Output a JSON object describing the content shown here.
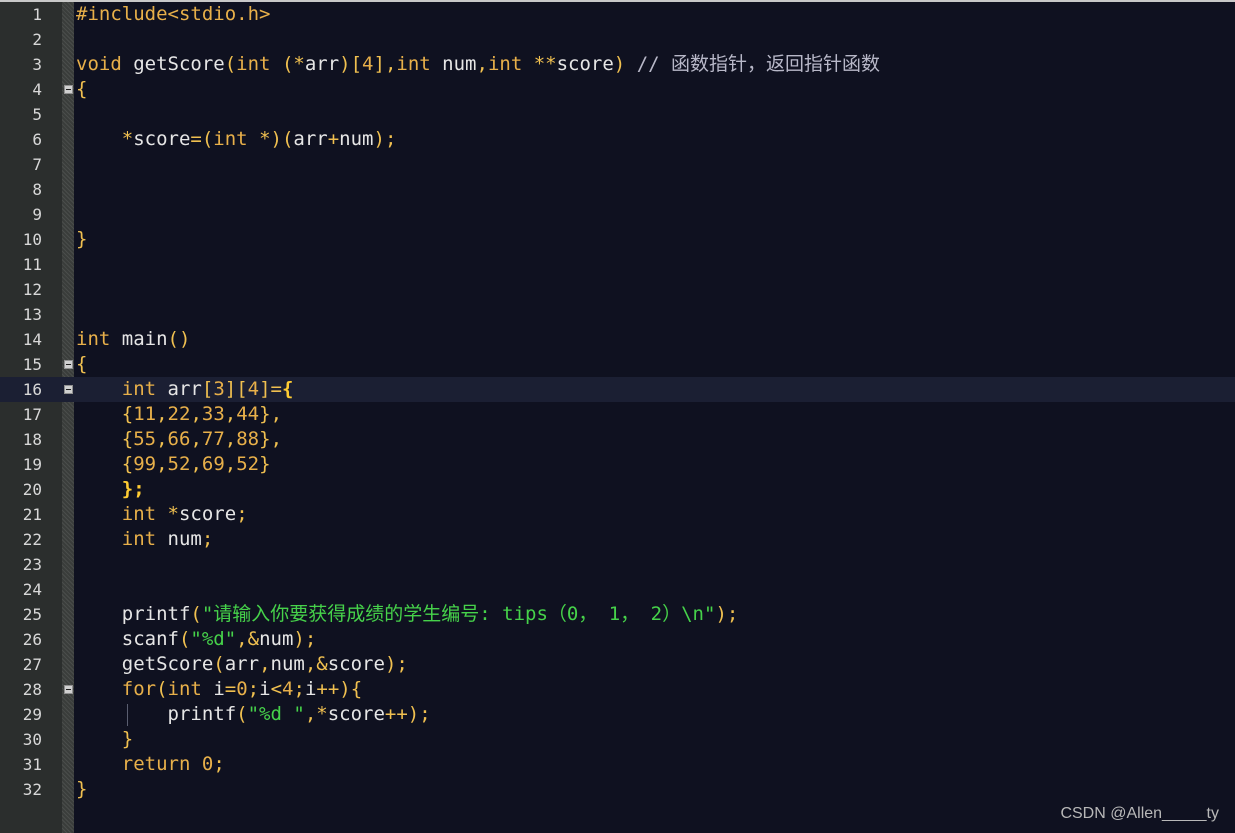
{
  "editor": {
    "current_line": 16,
    "lines": [
      {
        "num": "1",
        "fold": false,
        "tokens": [
          {
            "t": "#include<stdio.h>",
            "c": "pre"
          }
        ]
      },
      {
        "num": "2",
        "fold": false,
        "tokens": []
      },
      {
        "num": "3",
        "fold": false,
        "tokens": [
          {
            "t": "void",
            "c": "kw"
          },
          {
            "t": " getScore",
            "c": "fn"
          },
          {
            "t": "(",
            "c": "op"
          },
          {
            "t": "int",
            "c": "kw"
          },
          {
            "t": " (*",
            "c": "op"
          },
          {
            "t": "arr",
            "c": "id"
          },
          {
            "t": ")[",
            "c": "op"
          },
          {
            "t": "4",
            "c": "num"
          },
          {
            "t": "],",
            "c": "op"
          },
          {
            "t": "int",
            "c": "kw"
          },
          {
            "t": " num",
            "c": "id"
          },
          {
            "t": ",",
            "c": "op"
          },
          {
            "t": "int",
            "c": "kw"
          },
          {
            "t": " **",
            "c": "op"
          },
          {
            "t": "score",
            "c": "id"
          },
          {
            "t": ") ",
            "c": "op"
          },
          {
            "t": "// 函数指针，返回指针函数",
            "c": "cm"
          }
        ]
      },
      {
        "num": "4",
        "fold": true,
        "tokens": [
          {
            "t": "{",
            "c": "br"
          }
        ]
      },
      {
        "num": "5",
        "fold": false,
        "tokens": []
      },
      {
        "num": "6",
        "fold": false,
        "tokens": [
          {
            "t": "    *",
            "c": "op"
          },
          {
            "t": "score",
            "c": "id"
          },
          {
            "t": "=(",
            "c": "op"
          },
          {
            "t": "int",
            "c": "kw"
          },
          {
            "t": " *)(",
            "c": "op"
          },
          {
            "t": "arr",
            "c": "id"
          },
          {
            "t": "+",
            "c": "op"
          },
          {
            "t": "num",
            "c": "id"
          },
          {
            "t": ");",
            "c": "op"
          }
        ]
      },
      {
        "num": "7",
        "fold": false,
        "tokens": []
      },
      {
        "num": "8",
        "fold": false,
        "tokens": []
      },
      {
        "num": "9",
        "fold": false,
        "tokens": []
      },
      {
        "num": "10",
        "fold": false,
        "tokens": [
          {
            "t": "}",
            "c": "br"
          }
        ]
      },
      {
        "num": "11",
        "fold": false,
        "tokens": []
      },
      {
        "num": "12",
        "fold": false,
        "tokens": []
      },
      {
        "num": "13",
        "fold": false,
        "tokens": []
      },
      {
        "num": "14",
        "fold": false,
        "tokens": [
          {
            "t": "int",
            "c": "kw"
          },
          {
            "t": " main",
            "c": "fn"
          },
          {
            "t": "()",
            "c": "op"
          }
        ]
      },
      {
        "num": "15",
        "fold": true,
        "tokens": [
          {
            "t": "{",
            "c": "br"
          }
        ]
      },
      {
        "num": "16",
        "fold": true,
        "tokens": [
          {
            "t": "    ",
            "c": "id"
          },
          {
            "t": "int",
            "c": "kw"
          },
          {
            "t": " arr",
            "c": "id"
          },
          {
            "t": "[",
            "c": "op"
          },
          {
            "t": "3",
            "c": "num"
          },
          {
            "t": "][",
            "c": "op"
          },
          {
            "t": "4",
            "c": "num"
          },
          {
            "t": "]=",
            "c": "op"
          },
          {
            "t": "{",
            "c": "bold"
          }
        ]
      },
      {
        "num": "17",
        "fold": false,
        "tokens": [
          {
            "t": "    {",
            "c": "op"
          },
          {
            "t": "11",
            "c": "num"
          },
          {
            "t": ",",
            "c": "op"
          },
          {
            "t": "22",
            "c": "num"
          },
          {
            "t": ",",
            "c": "op"
          },
          {
            "t": "33",
            "c": "num"
          },
          {
            "t": ",",
            "c": "op"
          },
          {
            "t": "44",
            "c": "num"
          },
          {
            "t": "},",
            "c": "op"
          }
        ]
      },
      {
        "num": "18",
        "fold": false,
        "tokens": [
          {
            "t": "    {",
            "c": "op"
          },
          {
            "t": "55",
            "c": "num"
          },
          {
            "t": ",",
            "c": "op"
          },
          {
            "t": "66",
            "c": "num"
          },
          {
            "t": ",",
            "c": "op"
          },
          {
            "t": "77",
            "c": "num"
          },
          {
            "t": ",",
            "c": "op"
          },
          {
            "t": "88",
            "c": "num"
          },
          {
            "t": "},",
            "c": "op"
          }
        ]
      },
      {
        "num": "19",
        "fold": false,
        "tokens": [
          {
            "t": "    {",
            "c": "op"
          },
          {
            "t": "99",
            "c": "num"
          },
          {
            "t": ",",
            "c": "op"
          },
          {
            "t": "52",
            "c": "num"
          },
          {
            "t": ",",
            "c": "op"
          },
          {
            "t": "69",
            "c": "num"
          },
          {
            "t": ",",
            "c": "op"
          },
          {
            "t": "52",
            "c": "num"
          },
          {
            "t": "}",
            "c": "op"
          }
        ]
      },
      {
        "num": "20",
        "fold": false,
        "tokens": [
          {
            "t": "    ",
            "c": "id"
          },
          {
            "t": "};",
            "c": "bold"
          }
        ]
      },
      {
        "num": "21",
        "fold": false,
        "tokens": [
          {
            "t": "    ",
            "c": "id"
          },
          {
            "t": "int",
            "c": "kw"
          },
          {
            "t": " *",
            "c": "op"
          },
          {
            "t": "score",
            "c": "id"
          },
          {
            "t": ";",
            "c": "op"
          }
        ]
      },
      {
        "num": "22",
        "fold": false,
        "tokens": [
          {
            "t": "    ",
            "c": "id"
          },
          {
            "t": "int",
            "c": "kw"
          },
          {
            "t": " num",
            "c": "id"
          },
          {
            "t": ";",
            "c": "op"
          }
        ]
      },
      {
        "num": "23",
        "fold": false,
        "tokens": []
      },
      {
        "num": "24",
        "fold": false,
        "tokens": []
      },
      {
        "num": "25",
        "fold": false,
        "tokens": [
          {
            "t": "    printf",
            "c": "fn"
          },
          {
            "t": "(",
            "c": "op"
          },
          {
            "t": "\"请输入你要获得成绩的学生编号: tips（0， 1， 2）\\n\"",
            "c": "str"
          },
          {
            "t": ");",
            "c": "op"
          }
        ]
      },
      {
        "num": "26",
        "fold": false,
        "tokens": [
          {
            "t": "    scanf",
            "c": "fn"
          },
          {
            "t": "(",
            "c": "op"
          },
          {
            "t": "\"%d\"",
            "c": "str"
          },
          {
            "t": ",&",
            "c": "op"
          },
          {
            "t": "num",
            "c": "id"
          },
          {
            "t": ");",
            "c": "op"
          }
        ]
      },
      {
        "num": "27",
        "fold": false,
        "tokens": [
          {
            "t": "    getScore",
            "c": "fn"
          },
          {
            "t": "(",
            "c": "op"
          },
          {
            "t": "arr",
            "c": "id"
          },
          {
            "t": ",",
            "c": "op"
          },
          {
            "t": "num",
            "c": "id"
          },
          {
            "t": ",&",
            "c": "op"
          },
          {
            "t": "score",
            "c": "id"
          },
          {
            "t": ");",
            "c": "op"
          }
        ]
      },
      {
        "num": "28",
        "fold": true,
        "tokens": [
          {
            "t": "    ",
            "c": "id"
          },
          {
            "t": "for",
            "c": "kw"
          },
          {
            "t": "(",
            "c": "op"
          },
          {
            "t": "int",
            "c": "kw"
          },
          {
            "t": " i",
            "c": "id"
          },
          {
            "t": "=",
            "c": "op"
          },
          {
            "t": "0",
            "c": "num"
          },
          {
            "t": ";",
            "c": "op"
          },
          {
            "t": "i",
            "c": "id"
          },
          {
            "t": "<",
            "c": "op"
          },
          {
            "t": "4",
            "c": "num"
          },
          {
            "t": ";",
            "c": "op"
          },
          {
            "t": "i",
            "c": "id"
          },
          {
            "t": "++){",
            "c": "op"
          }
        ]
      },
      {
        "num": "29",
        "fold": false,
        "tokens": [
          {
            "t": "        printf",
            "c": "fn"
          },
          {
            "t": "(",
            "c": "op"
          },
          {
            "t": "\"%d \"",
            "c": "str"
          },
          {
            "t": ",*",
            "c": "op"
          },
          {
            "t": "score",
            "c": "id"
          },
          {
            "t": "++);",
            "c": "op"
          }
        ]
      },
      {
        "num": "30",
        "fold": false,
        "tokens": [
          {
            "t": "    }",
            "c": "br"
          }
        ]
      },
      {
        "num": "31",
        "fold": false,
        "tokens": [
          {
            "t": "    ",
            "c": "id"
          },
          {
            "t": "return",
            "c": "kw"
          },
          {
            "t": " ",
            "c": "id"
          },
          {
            "t": "0",
            "c": "num"
          },
          {
            "t": ";",
            "c": "op"
          }
        ]
      },
      {
        "num": "32",
        "fold": false,
        "tokens": [
          {
            "t": "}",
            "c": "br"
          }
        ]
      }
    ]
  },
  "watermark": "CSDN @Allen_____ty"
}
